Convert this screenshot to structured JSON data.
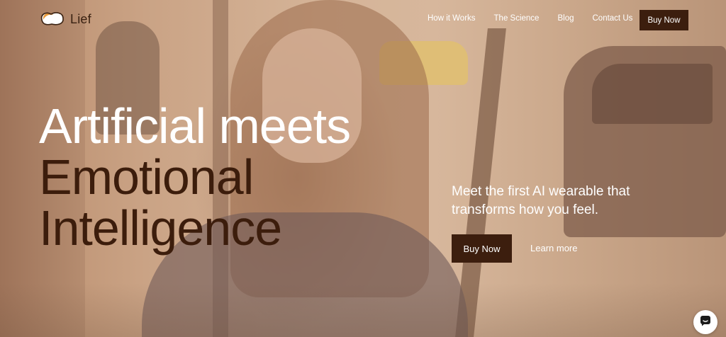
{
  "brand": {
    "name": "Lief"
  },
  "nav": {
    "links": [
      "How it Works",
      "The Science",
      "Blog",
      "Contact Us"
    ],
    "buy_label": "Buy Now"
  },
  "hero": {
    "line1": "Artificial meets",
    "line2": "Emotional",
    "line3": "Intelligence",
    "tagline": "Meet the first AI wearable that transforms how you feel.",
    "cta_primary": "Buy Now",
    "cta_secondary": "Learn more"
  },
  "colors": {
    "accent": "#3c1e0e",
    "overlay": "#c9a487",
    "text_light": "#ffffff"
  },
  "icons": {
    "logo": "lief-logo-icon",
    "chat": "chat-icon"
  }
}
